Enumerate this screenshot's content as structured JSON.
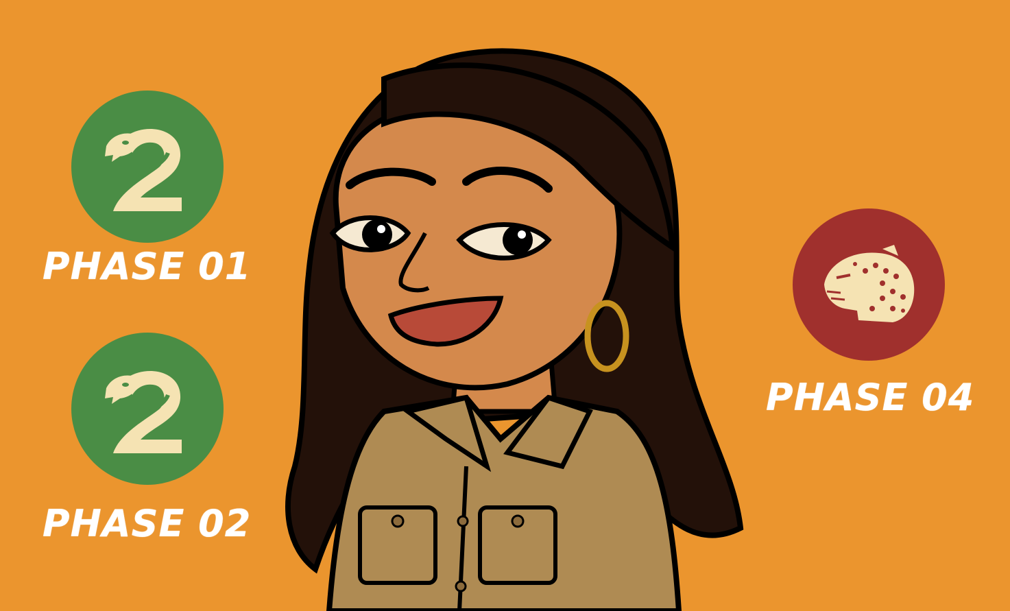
{
  "colors": {
    "background": "#EB952E",
    "snake_badge": "#4A8D45",
    "leopard_badge": "#A0302D",
    "icon_cream": "#F5E3B3",
    "label": "#FFFFFF"
  },
  "phases": [
    {
      "label": "PHASE 01",
      "icon": "snake-icon"
    },
    {
      "label": "PHASE 02",
      "icon": "snake-icon"
    },
    {
      "label": "PHASE 04",
      "icon": "leopard-icon"
    }
  ]
}
